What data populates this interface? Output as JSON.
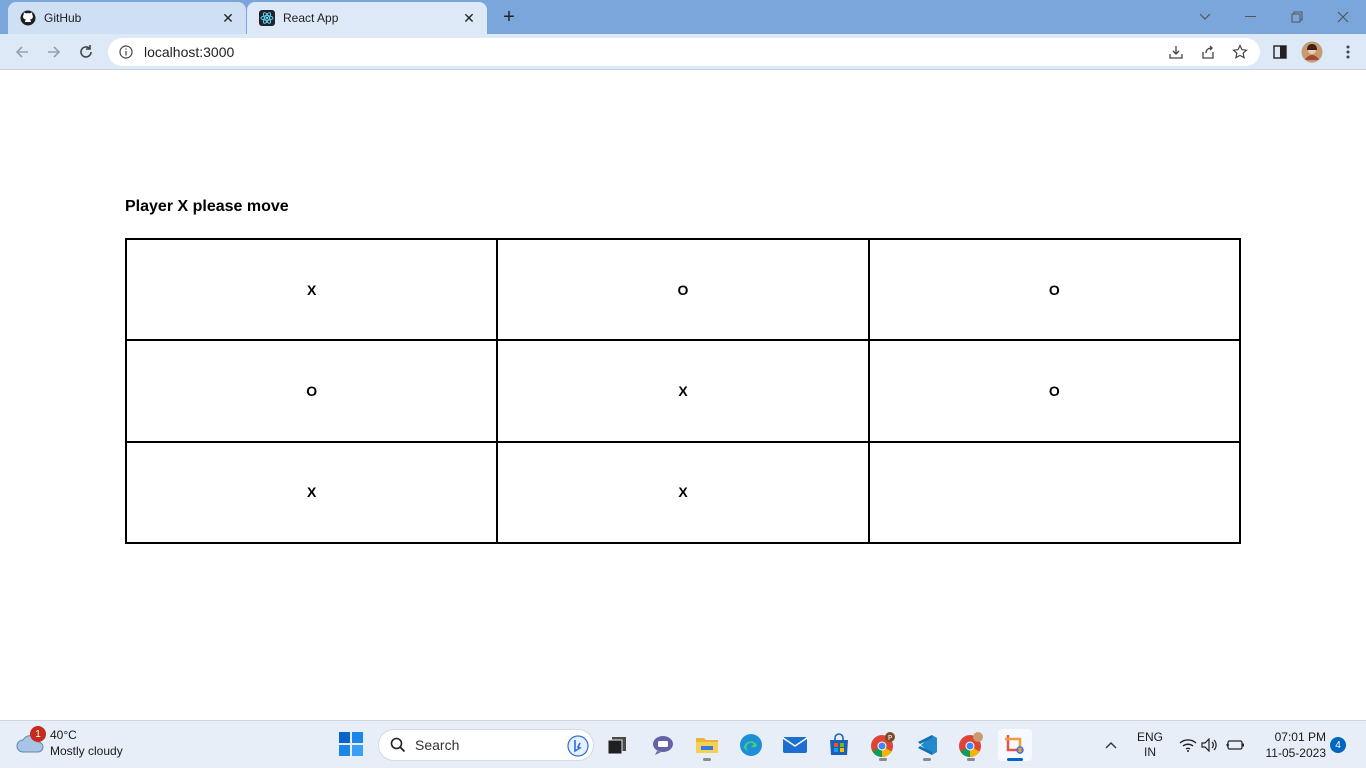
{
  "browser": {
    "tabs": [
      {
        "label": "GitHub",
        "icon": "github-icon",
        "active": false
      },
      {
        "label": "React App",
        "icon": "react-icon",
        "active": true
      }
    ],
    "url": "localhost:3000"
  },
  "game": {
    "status": "Player X please move",
    "board": [
      "X",
      "O",
      "O",
      "O",
      "X",
      "O",
      "X",
      "X",
      ""
    ]
  },
  "taskbar": {
    "weather": {
      "badge": "1",
      "temp": "40°C",
      "condition": "Mostly cloudy"
    },
    "search_label": "Search",
    "language_line1": "ENG",
    "language_line2": "IN",
    "time": "07:01 PM",
    "date": "11-05-2023",
    "notification_count": "4"
  }
}
